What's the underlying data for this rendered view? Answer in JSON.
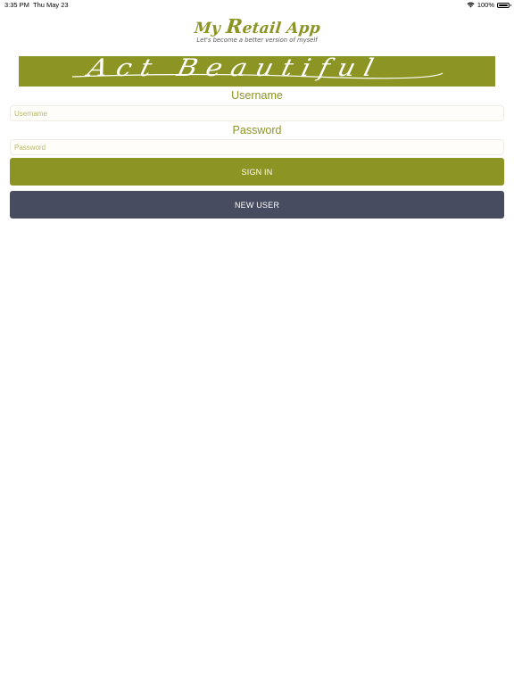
{
  "status_bar": {
    "time": "3:35 PM",
    "date": "Thu May 23",
    "battery": "100%",
    "icons": [
      "wifi-icon",
      "battery-icon"
    ],
    "battery_level": 1.0
  },
  "app": {
    "title_prefix": "My ",
    "title_initial": "R",
    "title_suffix": "etail App",
    "tagline": "Let's become a better version of myself"
  },
  "banner": {
    "text": "Act Beautiful"
  },
  "login": {
    "username_label": "Username",
    "username_placeholder": "Username",
    "username_value": "",
    "password_label": "Password",
    "password_placeholder": "Password",
    "password_value": "",
    "signin_label": "SIGN IN",
    "newuser_label": "NEW USER"
  },
  "colors": {
    "brand": "#8c9424",
    "secondary_button": "#474c61",
    "background": "#ffffff"
  }
}
